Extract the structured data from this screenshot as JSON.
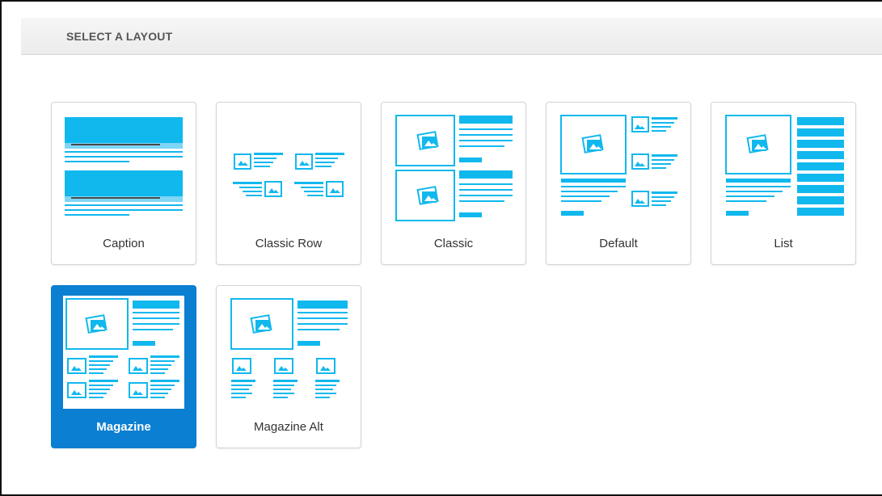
{
  "header": {
    "title": "SELECT A LAYOUT"
  },
  "layouts": [
    {
      "label": "Caption",
      "selected": false
    },
    {
      "label": "Classic Row",
      "selected": false
    },
    {
      "label": "Classic",
      "selected": false
    },
    {
      "label": "Default",
      "selected": false
    },
    {
      "label": "List",
      "selected": false
    },
    {
      "label": "Magazine",
      "selected": true
    },
    {
      "label": "Magazine Alt",
      "selected": false
    }
  ],
  "colors": {
    "accent": "#0b7fd1",
    "thumb_blue": "#11b8ee",
    "thumb_dark": "#4a4a4a",
    "header_text": "#555555"
  }
}
